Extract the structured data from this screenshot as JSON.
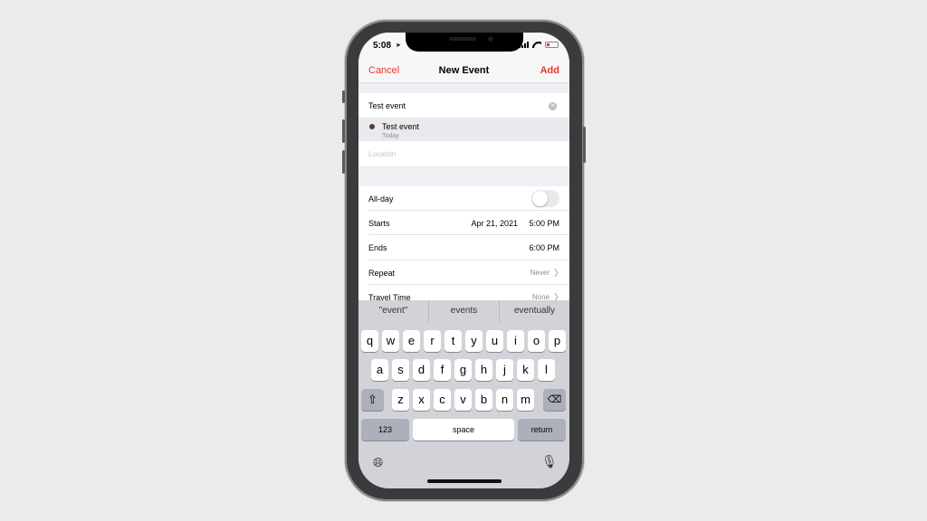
{
  "status": {
    "time": "5:08",
    "location_icon": "location-arrow-icon"
  },
  "nav": {
    "cancel": "Cancel",
    "title": "New Event",
    "add": "Add"
  },
  "title_field": {
    "value": "Test event"
  },
  "suggestion": {
    "name": "Test event",
    "sub": "Today"
  },
  "location_field": {
    "placeholder": "Location"
  },
  "rows": {
    "allday": {
      "label": "All-day"
    },
    "starts": {
      "label": "Starts",
      "date": "Apr 21, 2021",
      "time": "5:00 PM"
    },
    "ends": {
      "label": "Ends",
      "time": "6:00 PM"
    },
    "repeat": {
      "label": "Repeat",
      "value": "Never"
    },
    "travel": {
      "label": "Travel Time",
      "value": "None"
    }
  },
  "keyboard": {
    "predictions": [
      "\"event\"",
      "events",
      "eventually"
    ],
    "row1": [
      "q",
      "w",
      "e",
      "r",
      "t",
      "y",
      "u",
      "i",
      "o",
      "p"
    ],
    "row2": [
      "a",
      "s",
      "d",
      "f",
      "g",
      "h",
      "j",
      "k",
      "l"
    ],
    "row3": [
      "z",
      "x",
      "c",
      "v",
      "b",
      "n",
      "m"
    ],
    "numbers": "123",
    "space": "space",
    "return": "return"
  },
  "colors": {
    "accent": "#e5372c",
    "background": "#ebebeb"
  }
}
